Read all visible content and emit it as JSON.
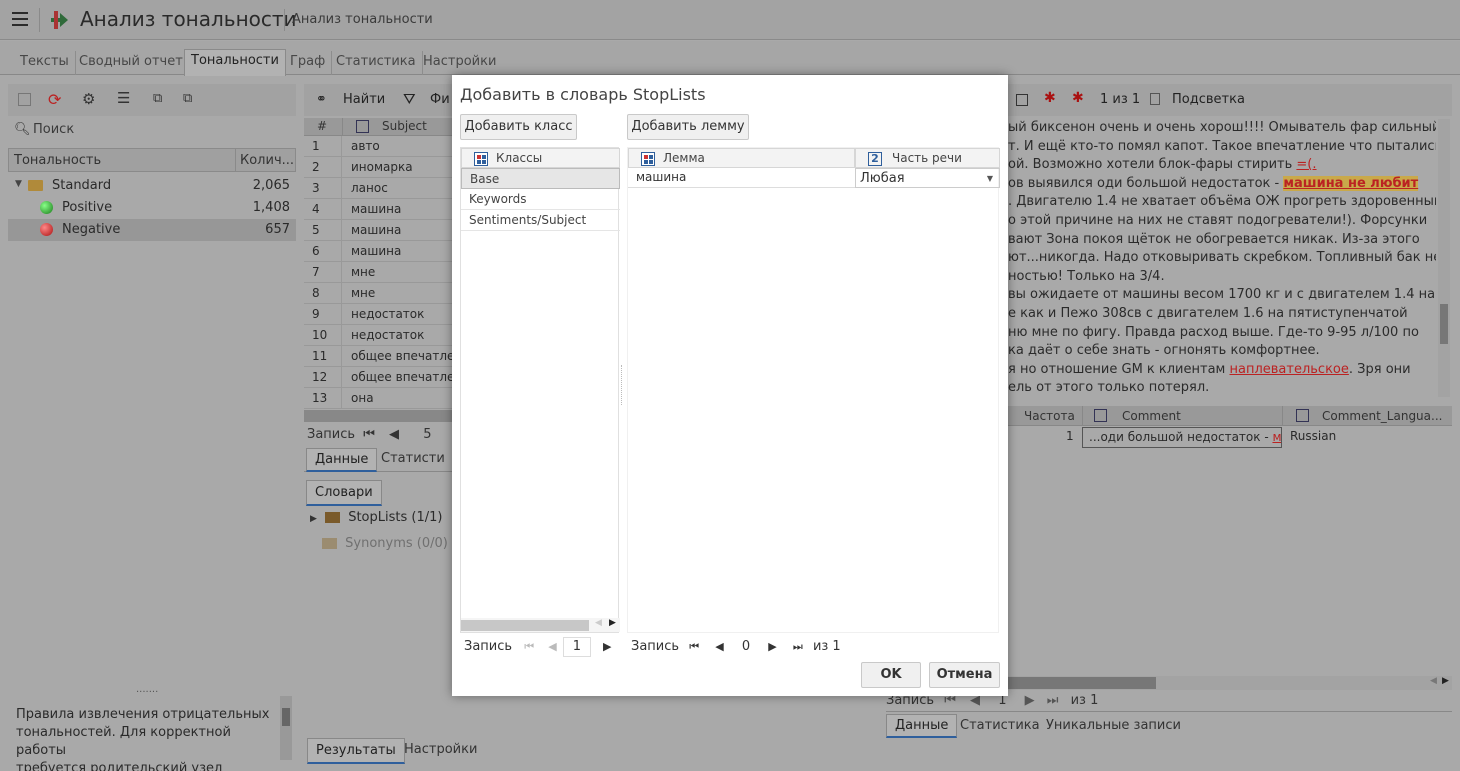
{
  "header": {
    "app_title": "Анализ тональности",
    "breadcrumb": "Анализ тональности"
  },
  "tabs": [
    "Тексты",
    "Сводный отчет",
    "Тональности",
    "Граф",
    "Статистика",
    "Настройки"
  ],
  "left": {
    "search_placeholder": "Поиск",
    "tree_headers": [
      "Тональность",
      "Колич..."
    ],
    "tree": [
      {
        "label": "Standard",
        "count": "2,065"
      },
      {
        "label": "Positive",
        "count": "1,408"
      },
      {
        "label": "Negative",
        "count": "657"
      }
    ],
    "info_text": [
      "Правила извлечения отрицательных",
      "тональностей. Для корректной работы",
      "требуется родительский узел"
    ]
  },
  "middle": {
    "toolbar": {
      "find": "Найти",
      "filter": "Фи"
    },
    "grid_headers": [
      "#",
      "Subject"
    ],
    "rows": [
      {
        "n": "1",
        "v": "авто"
      },
      {
        "n": "2",
        "v": "иномарка"
      },
      {
        "n": "3",
        "v": "ланос"
      },
      {
        "n": "4",
        "v": "машина"
      },
      {
        "n": "5",
        "v": "машина"
      },
      {
        "n": "6",
        "v": "машина"
      },
      {
        "n": "7",
        "v": "мне"
      },
      {
        "n": "8",
        "v": "мне"
      },
      {
        "n": "9",
        "v": "недостаток"
      },
      {
        "n": "10",
        "v": "недостаток"
      },
      {
        "n": "11",
        "v": "общее впечатлен"
      },
      {
        "n": "12",
        "v": "общее впечатлен"
      },
      {
        "n": "13",
        "v": "она"
      }
    ],
    "pager_label": "Запись",
    "pager_value": "5",
    "subtabs": [
      "Данные",
      "Статисти"
    ],
    "dict_tab": "Словари",
    "dicts": [
      "StopLists (1/1)",
      "Synonyms (0/0)"
    ],
    "bottom_tabs": [
      "Результаты",
      "Настройки"
    ]
  },
  "right": {
    "toolbar": {
      "count": "1 из 1",
      "highlight": "Подсветка"
    },
    "text_lines": [
      "ый биксенон очень и очень хорош!!!! Омыватель фар сильный",
      "т. И ещё кто-то помял капот. Такое впечатление что пытались",
      "ой. Возможно хотели блок-фары стирить ",
      "ов выявился оди большой недостаток - ",
      ". Двигателю 1.4 не хватает объёма ОЖ прогреть здоровенный",
      "о этой причине на них не ставят подогреватели!). Форсунки",
      "вают Зона покоя щёток не обогревается никак. Из-за этого",
      "ют...никогда. Надо отковыривать скребком. Топливный бак не",
      "ностью! Только на 3/4.",
      "вы ожидаете от машины весом 1700 кг и с двигателем 1.4 на",
      "е как и Пежо 308св с двигателем 1.6 на пятиступенчатой",
      "ню мне по фигу. Правда расход выше. Где-то 9-95 л/100 по",
      "ка даёт о себе знать - огнонять комфортнее.",
      "я но отношение GM к клиентам ",
      "ель от этого только потерял."
    ],
    "smiley": "=(.",
    "highlight_phrase": "машина не любит",
    "underlined_word": "наплевательское",
    "line14_tail": ". Зря они",
    "grid_headers": [
      "Частота",
      "Comment",
      "Comment_Langua..."
    ],
    "row": {
      "freq": "1",
      "comment": "...оди большой недостаток - ",
      "comment_hl": "маш",
      "lang": "Russian"
    },
    "pager_label": "Запись",
    "pager_value": "1",
    "pager_of": "из 1",
    "subtabs": [
      "Данные",
      "Статистика",
      "Уникальные записи"
    ]
  },
  "dialog": {
    "title": "Добавить в словарь StopLists",
    "add_class": "Добавить класс",
    "add_lemma": "Добавить лемму",
    "classes_header": "Классы",
    "classes": [
      "Base",
      "Keywords",
      "Sentiments/Subject"
    ],
    "lemma_header": "Лемма",
    "pos_header": "Часть речи",
    "lemma_rows": [
      {
        "lemma": "машина",
        "pos": "Любая"
      }
    ],
    "left_pager": {
      "label": "Запись",
      "value": "1"
    },
    "right_pager": {
      "label": "Запись",
      "value": "0",
      "of": "из 1"
    },
    "ok": "OK",
    "cancel": "Отмена"
  }
}
